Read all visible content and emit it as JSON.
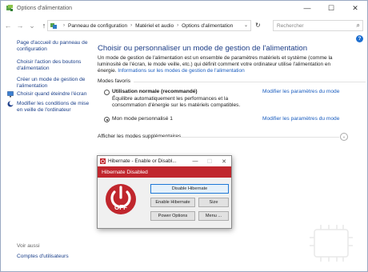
{
  "window": {
    "title": "Options d'alimentation",
    "controls": {
      "minimize": "—",
      "maximize": "☐",
      "close": "✕"
    }
  },
  "navbar": {
    "back": "←",
    "forward": "→",
    "history": "⌄",
    "up": "↑",
    "breadcrumb": [
      "Panneau de configuration",
      "Matériel et audio",
      "Options d'alimentation"
    ],
    "breadcrumb_separator": "›",
    "address_dropdown": "⌄",
    "refresh": "↻",
    "search_placeholder": "Rechercher",
    "search_glyph": "⌕",
    "help": "?"
  },
  "sidebar": {
    "links": [
      {
        "label": "Page d'accueil du panneau de configuration"
      },
      {
        "label": "Choisir l'action des boutons d'alimentation"
      },
      {
        "label": "Créer un mode de gestion de l'alimentation"
      },
      {
        "label": "Choisir quand éteindre l'écran",
        "icon": "monitor-icon"
      },
      {
        "label": "Modifier les conditions de mise en veille de l'ordinateur",
        "icon": "moon-icon"
      }
    ],
    "see_also": "Voir aussi",
    "see_also_links": [
      {
        "label": "Comptes d'utilisateurs"
      }
    ]
  },
  "main": {
    "title": "Choisir ou personnaliser un mode de gestion de l'alimentation",
    "description": "Un mode de gestion de l'alimentation est un ensemble de paramètres matériels et système (comme la luminosité de l'écran, le mode veille, etc.) qui définit comment votre ordinateur utilise l'alimentation en énergie. ",
    "description_link": "Informations sur les modes de gestion de l'alimentation",
    "favorites_label": "Modes favoris",
    "plans": [
      {
        "name": "Utilisation normale (recommandé)",
        "description": "Équilibre automatiquement les performances et la consommation d'énergie sur les matériels compatibles.",
        "modify": "Modifier les paramètres du mode",
        "selected": false
      },
      {
        "name": "Mon mode personnalisé 1",
        "description": "",
        "modify": "Modifier les paramètres du mode",
        "selected": true
      }
    ],
    "more_plans": "Afficher les modes supplémentaires",
    "more_chevron": "⌄"
  },
  "popup": {
    "title": "Hibernate - Enable or Disabl...",
    "controls": {
      "minimize": "—",
      "maximize": "☐",
      "close": "✕"
    },
    "banner": "Hibernate Disabled",
    "logo_text": "OFF",
    "buttons": {
      "disable": "Disable Hibernate",
      "enable": "Enable Hibernate",
      "size": "Size",
      "power": "Power Options",
      "menu": "Menu ..."
    }
  },
  "colors": {
    "link": "#1a5dbf",
    "title": "#1c3d86",
    "banner": "#c0262d",
    "help": "#1e6fd0"
  }
}
